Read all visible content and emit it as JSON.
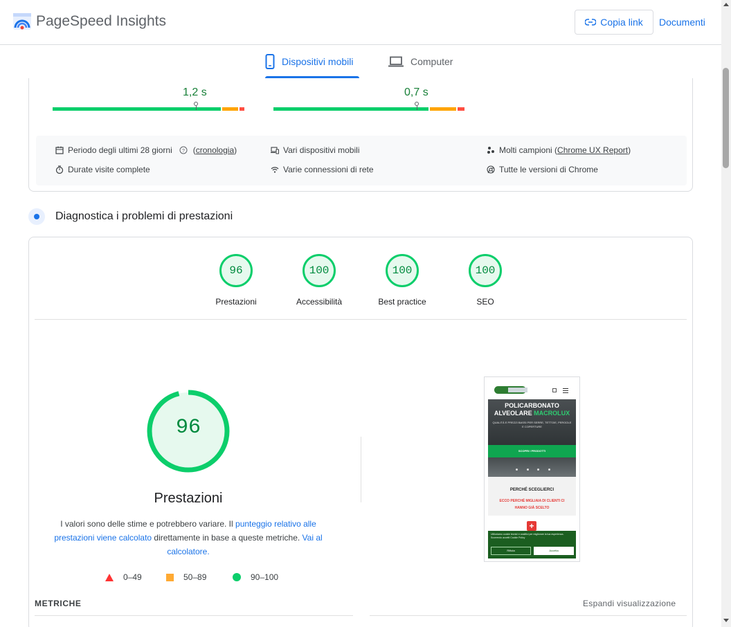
{
  "header": {
    "app_name": "PageSpeed Insights",
    "copy_link": "Copia link",
    "docs": "Documenti"
  },
  "tabs": [
    {
      "label": "Dispositivi mobili",
      "active": true,
      "icon": "smartphone-icon"
    },
    {
      "label": "Computer",
      "active": false,
      "icon": "laptop-icon"
    }
  ],
  "field_data": {
    "metrics": [
      {
        "value": "1,2 s",
        "distribution": {
          "good": 0.88,
          "needs_improvement": 0.09,
          "poor": 0.03
        },
        "marker_fraction": 0.75
      },
      {
        "value": "0,7 s",
        "distribution": {
          "good": 0.82,
          "needs_improvement": 0.14,
          "poor": 0.04
        },
        "marker_fraction": 0.75
      }
    ],
    "info": {
      "period": "Periodo degli ultimi 28 giorni",
      "period_link": "cronologia",
      "devices": "Vari dispositivi mobili",
      "samples_prefix": "Molti campioni (",
      "samples_link": "Chrome UX Report",
      "samples_suffix": ")",
      "visits": "Durate visite complete",
      "network": "Varie connessioni di rete",
      "chrome": "Tutte le versioni di Chrome"
    }
  },
  "diagnostics": {
    "title": "Diagnostica i problemi di prestazioni",
    "scores": [
      {
        "value": "96",
        "label": "Prestazioni"
      },
      {
        "value": "100",
        "label": "Accessibilità"
      },
      {
        "value": "100",
        "label": "Best practice"
      },
      {
        "value": "100",
        "label": "SEO"
      }
    ],
    "main_score": "96",
    "main_score_fraction": 0.96,
    "main_label": "Prestazioni",
    "disclaimer": {
      "part1": "I valori sono delle stime e potrebbero variare. Il ",
      "link1": "punteggio relativo alle prestazioni viene calcolato",
      "part2": " direttamente in base a queste metriche. ",
      "link2": "Vai al calcolatore."
    },
    "legend": [
      {
        "range": "0–49",
        "color": "#ff3333"
      },
      {
        "range": "50–89",
        "color": "#ffaa33"
      },
      {
        "range": "90–100",
        "color": "#0cce6b"
      }
    ],
    "metrics_title": "METRICHE",
    "expand": "Espandi visualizzazione"
  },
  "screenshot": {
    "headline_1": "POLICARBONATO",
    "headline_2a": "ALVEOLARE ",
    "headline_2b": "MACROLUX",
    "subtitle": "QUALITÀ E PREZZI BASSI PER SERRE, TETTOIE, PERGOLE E COPERTURE",
    "cta": "SCOPRI I PRODOTTI",
    "why": "PERCHÉ SCEGLIERCI",
    "why_sub": "ECCO PERCHÉ MIGLIAIA DI CLIENTI CI HANNO GIÀ SCELTO",
    "cookie_text": "Utilizziamo cookie tecnici e analitici per migliorare la tua esperienza. Scorrendo accetti Cookie Policy",
    "reject": "Rifiuta",
    "accept": "Accetta"
  },
  "colors": {
    "accent": "#1a73e8",
    "good": "#0cce6b",
    "average": "#ffaa33",
    "poor": "#ff3333"
  }
}
